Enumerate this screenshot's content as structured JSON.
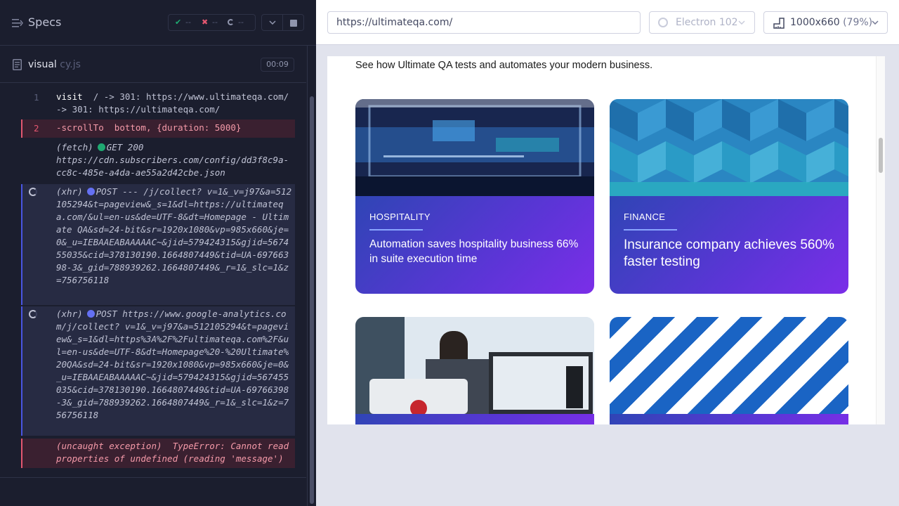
{
  "reporter": {
    "title": "Specs",
    "stats": {
      "passed": "--",
      "failed": "--",
      "pending": "--"
    },
    "spec": {
      "name": "visual",
      "ext": " cy.js",
      "duration": "00:09"
    }
  },
  "commands": [
    {
      "num": "1",
      "name": "visit",
      "message": "/ -> 301: https://www.ultimateqa.com/ -> 301: https://ultimateqa.com/"
    },
    {
      "num": "2",
      "name": "-scrollTo",
      "message": "bottom, {duration: 5000}",
      "state": "failed"
    },
    {
      "name": "(fetch)",
      "status": "GET 200",
      "message": "https://cdn.subscribers.com/config/dd3f8c9a-cc8c-485e-a4da-ae55a2d42cbe.json"
    },
    {
      "name": "(xhr)",
      "status": "POST --- /j/collect?",
      "message": "v=1&_v=j97&a=512105294&t=pageview&_s=1&dl=https://ultimateqa.com/&ul=en-us&de=UTF-8&dt=Homepage - Ultimate QA&sd=24-bit&sr=1920x1080&vp=985x660&je=0&_u=IEBAAEABAAAAAC~&jid=579424315&gjid=567455035&cid=378130190.1664807449&tid=UA-69766398-3&_gid=788939262.1664807449&_r=1&_slc=1&z=756756118"
    },
    {
      "name": "(xhr)",
      "status": "POST https://www.google-analytics.com/j/collect?",
      "message": "v=1&_v=j97&a=512105294&t=pageview&_s=1&dl=https%3A%2F%2Fultimateqa.com%2F&ul=en-us&de=UTF-8&dt=Homepage%20-%20Ultimate%20QA&sd=24-bit&sr=1920x1080&vp=985x660&je=0&_u=IEBAAEABAAAAAC~&jid=579424315&gjid=567455035&cid=378130190.1664807449&tid=UA-69766398-3&_gid=788939262.1664807449&_r=1&_slc=1&z=756756118"
    },
    {
      "name": "(uncaught exception)",
      "message": "TypeError: Cannot read properties of undefined (reading 'message')",
      "state": "failed"
    }
  ],
  "browser_bar": {
    "url": "https://ultimateqa.com/",
    "browser": "Electron 102",
    "viewport": "1000x660",
    "scale": "(79%)"
  },
  "app": {
    "intro": "See how Ultimate QA tests and automates your modern business.",
    "cards": [
      {
        "category": "HOSPITALITY",
        "title": "Automation saves hospitality business 66% in suite execution time"
      },
      {
        "category": "FINANCE",
        "title": "Insurance company achieves 560% faster testing"
      }
    ]
  },
  "colors": {
    "reporter_bg": "#1b1e2e",
    "failed": "#e45770",
    "passed": "#1fa971",
    "xhr_dot": "#6470f3",
    "card_gradient_start": "#2f45b5",
    "card_gradient_end": "#7b2ee8"
  }
}
